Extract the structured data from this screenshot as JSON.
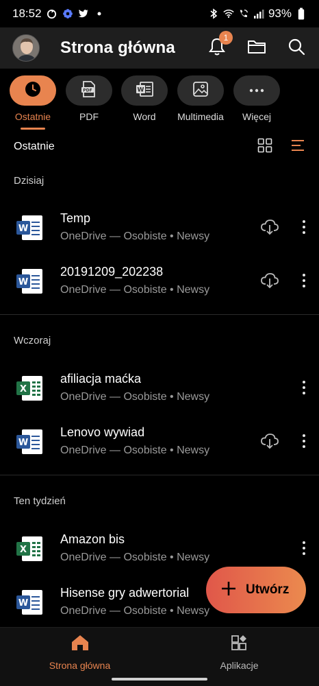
{
  "status_bar": {
    "time": "18:52",
    "battery": "93%",
    "left_icons": [
      "sync-icon",
      "settings-flower-icon",
      "twitter-icon",
      "dot-icon"
    ],
    "right_icons": [
      "bluetooth-icon",
      "wifi-icon",
      "wifi-calling-icon",
      "signal-icon",
      "battery-icon"
    ]
  },
  "header": {
    "title": "Strona główna",
    "notification_count": "1",
    "icons": [
      "bell-icon",
      "folder-icon",
      "search-icon"
    ]
  },
  "filters": [
    {
      "label": "Ostatnie",
      "icon": "clock-icon",
      "active": true
    },
    {
      "label": "PDF",
      "icon": "pdf-icon",
      "active": false
    },
    {
      "label": "Word",
      "icon": "word-icon",
      "active": false
    },
    {
      "label": "Multimedia",
      "icon": "image-icon",
      "active": false
    },
    {
      "label": "Więcej",
      "icon": "more-horizontal-icon",
      "active": false
    }
  ],
  "section": {
    "title": "Ostatnie",
    "view_icons": [
      "grid-view-icon",
      "sort-list-icon"
    ]
  },
  "groups": [
    {
      "label": "Dzisiaj",
      "files": [
        {
          "name": "Temp",
          "meta": "OneDrive — Osobiste • Newsy",
          "type": "word",
          "cloud": true
        },
        {
          "name": "20191209_202238",
          "meta": "OneDrive — Osobiste • Newsy",
          "type": "word",
          "cloud": true
        }
      ]
    },
    {
      "label": "Wczoraj",
      "files": [
        {
          "name": "afiliacja maćka",
          "meta": "OneDrive — Osobiste • Newsy",
          "type": "excel",
          "cloud": false
        },
        {
          "name": "Lenovo wywiad",
          "meta": "OneDrive — Osobiste • Newsy",
          "type": "word",
          "cloud": true
        }
      ]
    },
    {
      "label": "Ten tydzień",
      "files": [
        {
          "name": "Amazon bis",
          "meta": "OneDrive — Osobiste • Newsy",
          "type": "excel",
          "cloud": false
        },
        {
          "name": "Hisense gry adwertorial",
          "meta": "OneDrive — Osobiste • Newsy",
          "type": "word",
          "cloud": false
        }
      ]
    }
  ],
  "fab": {
    "label": "Utwórz",
    "icon": "plus-icon"
  },
  "bottom_nav": [
    {
      "label": "Strona główna",
      "icon": "home-icon",
      "active": true
    },
    {
      "label": "Aplikacje",
      "icon": "apps-icon",
      "active": false
    }
  ],
  "colors": {
    "accent": "#e8844f",
    "word_blue": "#2b579a",
    "excel_green": "#217346",
    "header_bg": "#1e1e1e",
    "background": "#000000"
  }
}
